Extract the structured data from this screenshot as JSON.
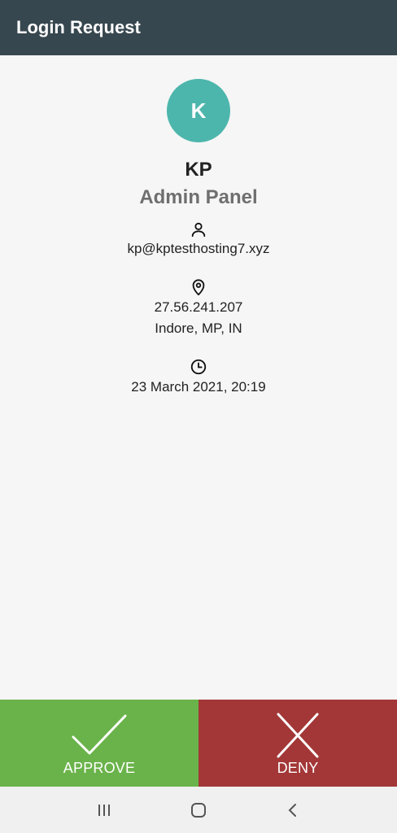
{
  "header": {
    "title": "Login Request"
  },
  "request": {
    "avatar_letter": "K",
    "account_name": "KP",
    "issuer": "Admin Panel",
    "user_email": "kp@kptesthosting7.xyz",
    "ip_address": "27.56.241.207",
    "location": "Indore, MP, IN",
    "timestamp": "23 March 2021, 20:19"
  },
  "actions": {
    "approve_label": "APPROVE",
    "deny_label": "DENY"
  },
  "icons": {
    "user": "person-icon",
    "location": "map-pin-icon",
    "time": "clock-icon",
    "approve": "check-icon",
    "deny": "x-icon"
  },
  "colors": {
    "header_bg": "#37474f",
    "avatar_bg": "#4db6ac",
    "approve_bg": "#6ab34a",
    "deny_bg": "#a33737"
  }
}
